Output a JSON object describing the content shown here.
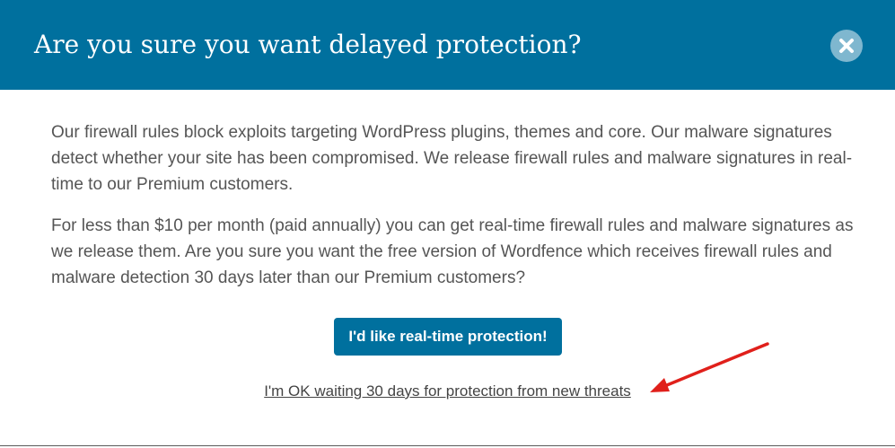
{
  "modal": {
    "title": "Are you sure you want delayed protection?",
    "close_icon": "close-icon",
    "paragraphs": [
      "Our firewall rules block exploits targeting WordPress plugins, themes and core. Our malware signatures detect whether your site has been compromised. We release firewall rules and malware signatures in real-time to our Premium customers.",
      "For less than $10 per month (paid annually) you can get real-time firewall rules and malware signatures as we release them. Are you sure you want the free version of Wordfence which receives firewall rules and malware detection 30 days later than our Premium customers?"
    ],
    "primary_button": "I'd like real-time protection!",
    "decline_link": "I'm OK waiting 30 days for protection from new threats"
  },
  "colors": {
    "header_bg": "#00709e",
    "button_bg": "#00709e",
    "close_bg": "#7fb7cf",
    "body_text": "#555555",
    "annotation_arrow": "#e0201b"
  }
}
